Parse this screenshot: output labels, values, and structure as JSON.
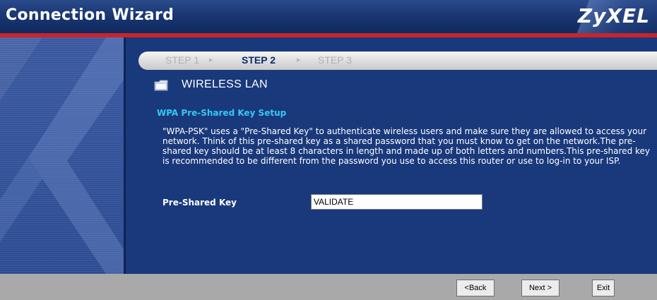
{
  "window": {
    "title": "Connection Wizard",
    "brand": "ZyXEL"
  },
  "steps": {
    "items": [
      {
        "label": "STEP 1",
        "state": "inactive"
      },
      {
        "label": "STEP 2",
        "state": "active"
      },
      {
        "label": "STEP 3",
        "state": "inactive"
      }
    ],
    "separator": "▸"
  },
  "section": {
    "icon": "folder-icon",
    "title": "WIRELESS LAN"
  },
  "content": {
    "subheading": "WPA Pre-Shared Key Setup",
    "description": "\"WPA-PSK\" uses a \"Pre-Shared Key\" to authenticate wireless users and make sure they are allowed to access your network. Think of this pre-shared key as a shared password that you must know to get on the network.The pre-shared key should be at least 8 characters in length and made up of both letters and numbers.This pre-shared key is recommended to be different from the password you use to access this router or use to log-in to your ISP.",
    "field": {
      "label": "Pre-Shared Key",
      "value": "VALIDATE"
    }
  },
  "footer": {
    "back_label": "<Back",
    "next_label": "Next >",
    "exit_label": "Exit"
  },
  "colors": {
    "title_bar": "#193572",
    "accent_red": "#c8242c",
    "body_bg": "#1a3a7e",
    "subheading": "#36c8f5",
    "footer": "#a9a9a9"
  }
}
